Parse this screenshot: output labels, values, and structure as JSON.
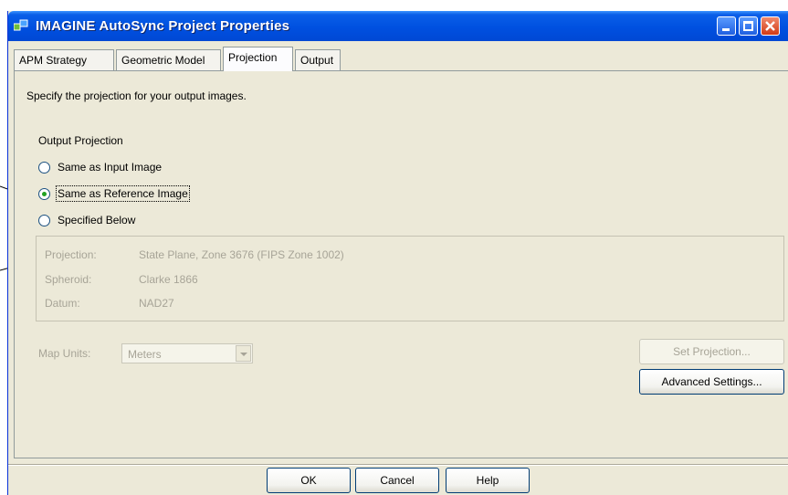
{
  "window": {
    "title": "IMAGINE AutoSync Project Properties"
  },
  "tabs": [
    {
      "label": "APM Strategy"
    },
    {
      "label": "Geometric Model"
    },
    {
      "label": "Projection"
    },
    {
      "label": "Output"
    }
  ],
  "instructions": "Specify the projection for your output images.",
  "output_projection": {
    "heading": "Output Projection",
    "options": [
      {
        "label": "Same as Input Image",
        "checked": false
      },
      {
        "label": "Same as Reference Image",
        "checked": true
      },
      {
        "label": "Specified Below",
        "checked": false
      }
    ]
  },
  "projection_info": {
    "projection_label": "Projection:",
    "projection_value": "State Plane, Zone 3676 (FIPS Zone 1002)",
    "spheroid_label": "Spheroid:",
    "spheroid_value": "Clarke 1866",
    "datum_label": "Datum:",
    "datum_value": "NAD27"
  },
  "map_units": {
    "label": "Map Units:",
    "value": "Meters"
  },
  "buttons": {
    "set_projection": "Set Projection...",
    "advanced_settings": "Advanced Settings...",
    "ok": "OK",
    "cancel": "Cancel",
    "help": "Help"
  },
  "colors": {
    "titlebar": "#0050e0",
    "dialog_bg": "#ece9d8",
    "disabled_text": "#a7a497"
  }
}
